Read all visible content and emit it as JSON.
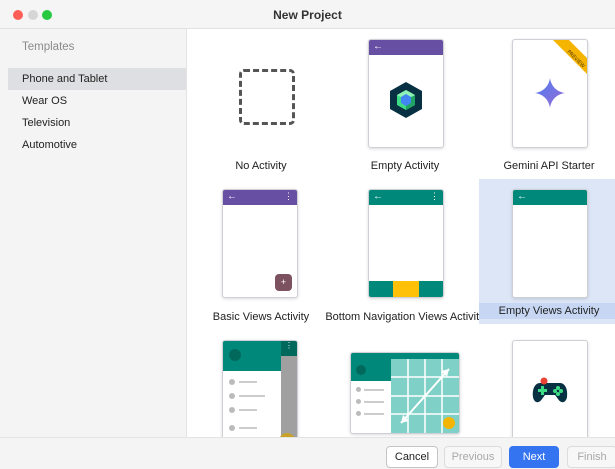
{
  "window": {
    "title": "New Project"
  },
  "sidebar": {
    "header": "Templates",
    "items": [
      {
        "label": "Phone and Tablet",
        "selected": true
      },
      {
        "label": "Wear OS"
      },
      {
        "label": "Television"
      },
      {
        "label": "Automotive"
      }
    ]
  },
  "templates": [
    {
      "label": "No Activity"
    },
    {
      "label": "Empty Activity"
    },
    {
      "label": "Gemini API Starter",
      "badge": "PREVIEW"
    },
    {
      "label": "Basic Views Activity",
      "fab": "+"
    },
    {
      "label": "Bottom Navigation Views Activity"
    },
    {
      "label": "Empty Views Activity",
      "selected": true
    },
    {
      "label": ""
    },
    {
      "label": ""
    },
    {
      "label": ""
    }
  ],
  "footer": {
    "cancel": "Cancel",
    "previous": "Previous",
    "next": "Next",
    "finish": "Finish"
  },
  "colors": {
    "purple_bar": "#6750a4",
    "teal_bar": "#00897b",
    "nav_yellow": "#ffc107",
    "accent_blue": "#3574f0"
  }
}
